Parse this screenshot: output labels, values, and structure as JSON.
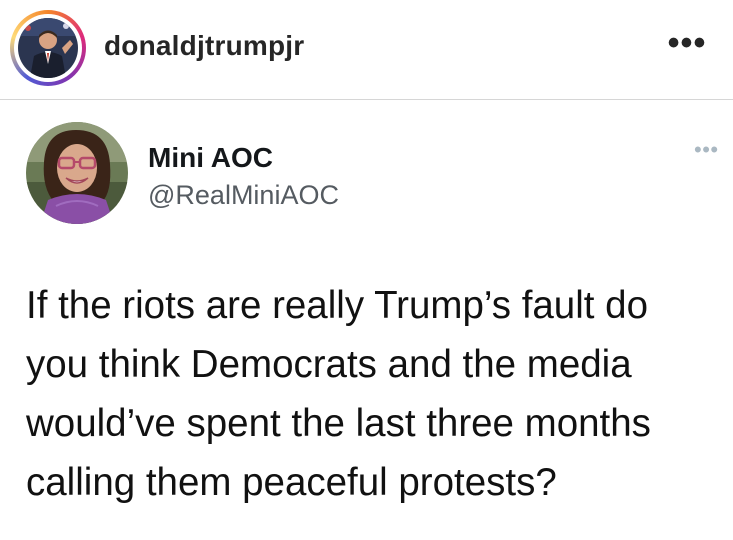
{
  "instagram_header": {
    "username": "donaldjtrumpjr",
    "avatar_icon": "profile-photo-icon",
    "more_icon": "more-options-icon",
    "more_glyph": "•••",
    "story_ring_colors": [
      "#f58529",
      "#dd2a7b",
      "#8134af",
      "#515bd4"
    ]
  },
  "tweet": {
    "display_name": "Mini AOC",
    "handle": "@RealMiniAOC",
    "avatar_icon": "profile-photo-icon",
    "more_glyph": "•••",
    "text": "If the riots are really Trump’s fault do\nyou think Democrats and the media\nwould’ve spent the last three months\ncalling them peaceful protests?"
  }
}
